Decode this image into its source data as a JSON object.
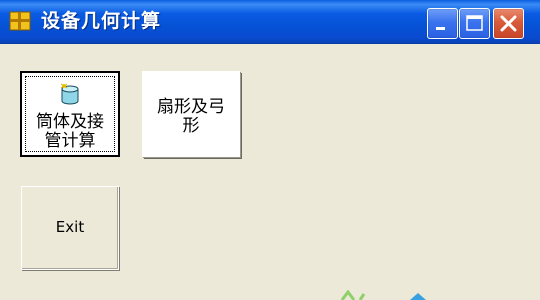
{
  "window": {
    "title": "设备几何计算"
  },
  "titlebar_buttons": [
    {
      "name": "minimize",
      "icon": "minimize-icon"
    },
    {
      "name": "maximize",
      "icon": "maximize-icon"
    },
    {
      "name": "close",
      "icon": "close-icon"
    }
  ],
  "buttons": {
    "cylinder": {
      "line1": "筒体及接",
      "line2": "管计算",
      "icon": "cylinder-icon"
    },
    "sector": {
      "line1": "扇形及弓",
      "line2": "形"
    },
    "exit": {
      "label": "Exit"
    }
  },
  "colors": {
    "titlebar": "#0552d6",
    "client_bg": "#ece9d8",
    "close_button": "#d85b3a"
  }
}
